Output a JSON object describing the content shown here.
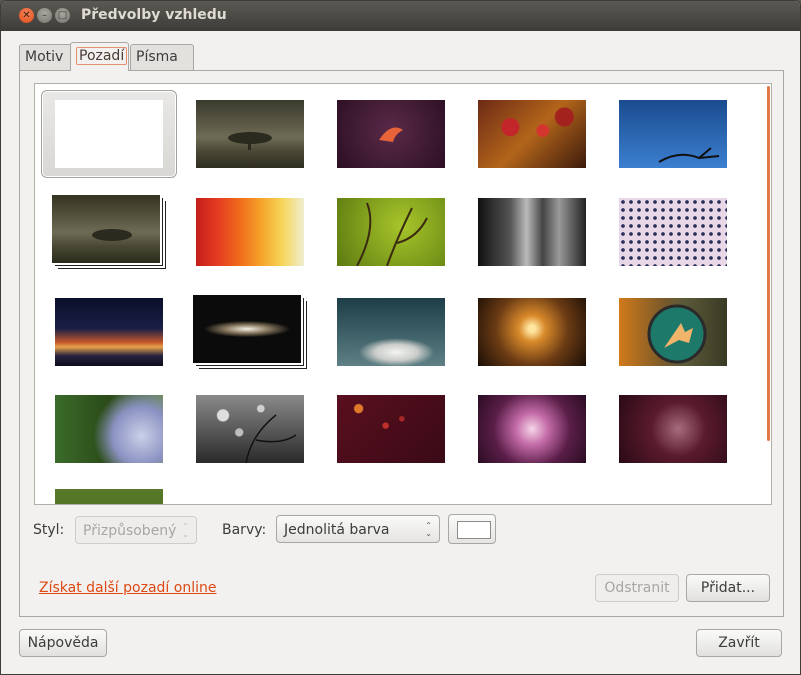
{
  "window": {
    "title": "Předvolby vzhledu"
  },
  "tabs": [
    {
      "label": "Motiv"
    },
    {
      "label": "Pozadí"
    },
    {
      "label": "Písma"
    }
  ],
  "gallery": {
    "selected_index": 0,
    "items": [
      {
        "name": "blank-white"
      },
      {
        "name": "lone-tree"
      },
      {
        "name": "purple-bird"
      },
      {
        "name": "red-berries"
      },
      {
        "name": "blue-sky-branch"
      },
      {
        "name": "tree-slideshow"
      },
      {
        "name": "colored-fabric"
      },
      {
        "name": "green-branches"
      },
      {
        "name": "bw-buildings"
      },
      {
        "name": "dotted-pattern"
      },
      {
        "name": "sunset-sky"
      },
      {
        "name": "galaxy-slideshow"
      },
      {
        "name": "clouds"
      },
      {
        "name": "field-sunset"
      },
      {
        "name": "arrow-sign"
      },
      {
        "name": "water-drops"
      },
      {
        "name": "bokeh-branches"
      },
      {
        "name": "red-bokeh"
      },
      {
        "name": "pink-light"
      },
      {
        "name": "dark-aubergine"
      },
      {
        "name": "green-partial"
      }
    ]
  },
  "style": {
    "label": "Styl:",
    "value": "Přizpůsobený"
  },
  "colors": {
    "label": "Barvy:",
    "value": "Jednolitá barva",
    "swatch": "#ffffff"
  },
  "link": {
    "label": "Získat další pozadí online"
  },
  "buttons": {
    "remove": "Odstranit",
    "add": "Přidat...",
    "help": "Nápověda",
    "close": "Zavřít"
  },
  "colors_theme": {
    "accent": "#dd4814",
    "scroll": "#e27846"
  }
}
